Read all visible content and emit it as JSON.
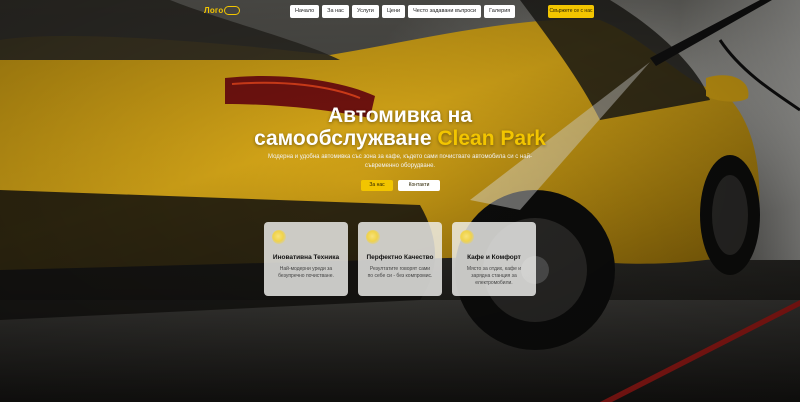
{
  "header": {
    "logo_text": "Лого",
    "nav": [
      "Начало",
      "За нас",
      "Услуги",
      "Цени",
      "Често задавани въпроси",
      "Галерия"
    ],
    "cta_label": "Свържете се с нас"
  },
  "hero": {
    "title_line1": "Автомивка на",
    "title_line2": "самообслужване ",
    "title_brand": "Clean Park",
    "subtitle": "Модерна и удобна автомивка със зона за кафе, където сами почиствате автомобила си с най-съвременно оборудване.",
    "button_about": "За нас",
    "button_contacts": "Контакти"
  },
  "features": [
    {
      "title": "Иновативна Техника",
      "text": "Най-модерни уреди за безупречно почистване."
    },
    {
      "title": "Перфектно Качество",
      "text": "Резултатите говорят сами по себе си - без компромис."
    },
    {
      "title": "Кафе и Комфорт",
      "text": "Място за отдих, кафе и зарядна станция за електромобили."
    }
  ],
  "colors": {
    "accent": "#f2c500",
    "car": "#e0a813",
    "card_bg": "#f0f0ee"
  }
}
